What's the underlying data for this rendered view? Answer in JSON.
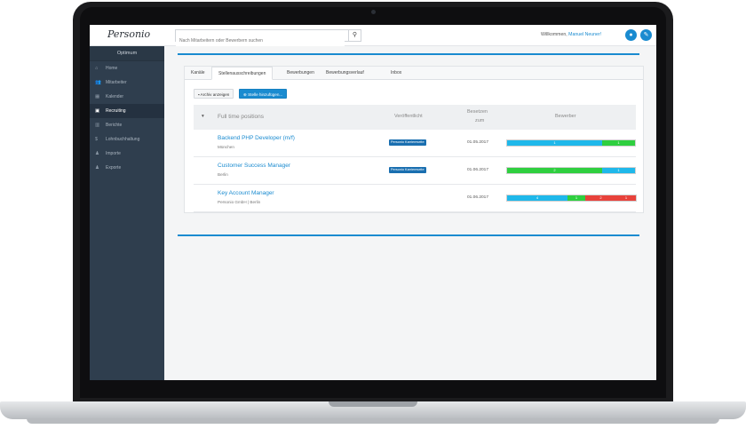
{
  "app": {
    "logo_text": "Personio",
    "search_placeholder": "Nach Mitarbeitern oder Bewerbern suchen",
    "welcome_text": "Willkommen,",
    "user_name": "Manuel Neuner!",
    "brand_color": "#1a8bd0"
  },
  "sidebar": {
    "company": "Optimum",
    "items": [
      {
        "label": "Home",
        "icon": "home-icon",
        "glyph": "⌂"
      },
      {
        "label": "Mitarbeiter",
        "icon": "users-icon",
        "glyph": "👥"
      },
      {
        "label": "Kalender",
        "icon": "calendar-icon",
        "glyph": "▦"
      },
      {
        "label": "Recruiting",
        "icon": "briefcase-icon",
        "glyph": "▣"
      },
      {
        "label": "Berichte",
        "icon": "chart-icon",
        "glyph": "▥"
      },
      {
        "label": "Lohnbuchhaltung",
        "icon": "dollar-icon",
        "glyph": "$"
      },
      {
        "label": "Importe",
        "icon": "user-import-icon",
        "glyph": "♟"
      },
      {
        "label": "Exporte",
        "icon": "user-export-icon",
        "glyph": "♟"
      }
    ]
  },
  "tabs": [
    "Kanäle",
    "Stellenausschreibungen",
    "Bewerbungen",
    "Bewerbungsverlauf",
    "Inbox"
  ],
  "toolbar": {
    "archive_label": "Archiv anzeigen",
    "add_label": "Stelle hinzufügen..."
  },
  "table": {
    "group_label": "Full time positions",
    "col_published": "Veröffentlicht",
    "col_filled_1": "Besetzen",
    "col_filled_2": "zum",
    "col_applicants": "Bewerber",
    "rows": [
      {
        "title": "Backend PHP Developer (m/f)",
        "location": "München",
        "channel": "Personio Karriereseite",
        "date": "01.05.2017",
        "segments": [
          {
            "value": "1",
            "color": "#1fb8ea",
            "share": 0.74
          },
          {
            "value": "1",
            "color": "#2fcf3f",
            "share": 0.26
          }
        ]
      },
      {
        "title": "Customer Success Manager",
        "location": "Berlin",
        "channel": "Personio Karriereseite",
        "date": "01.06.2017",
        "segments": [
          {
            "value": "2",
            "color": "#2fcf3f",
            "share": 0.74
          },
          {
            "value": "1",
            "color": "#1fb8ea",
            "share": 0.26
          }
        ]
      },
      {
        "title": "Key Account Manager",
        "location": "Personio GmbH | Berlin",
        "channel": "",
        "date": "01.06.2017",
        "segments": [
          {
            "value": "4",
            "color": "#1fb8ea",
            "share": 0.47
          },
          {
            "value": "1",
            "color": "#2fcf3f",
            "share": 0.14
          },
          {
            "value": "2",
            "color": "#e8423b",
            "share": 0.24
          },
          {
            "value": "1",
            "color": "#e8423b",
            "share": 0.15
          }
        ]
      }
    ]
  }
}
